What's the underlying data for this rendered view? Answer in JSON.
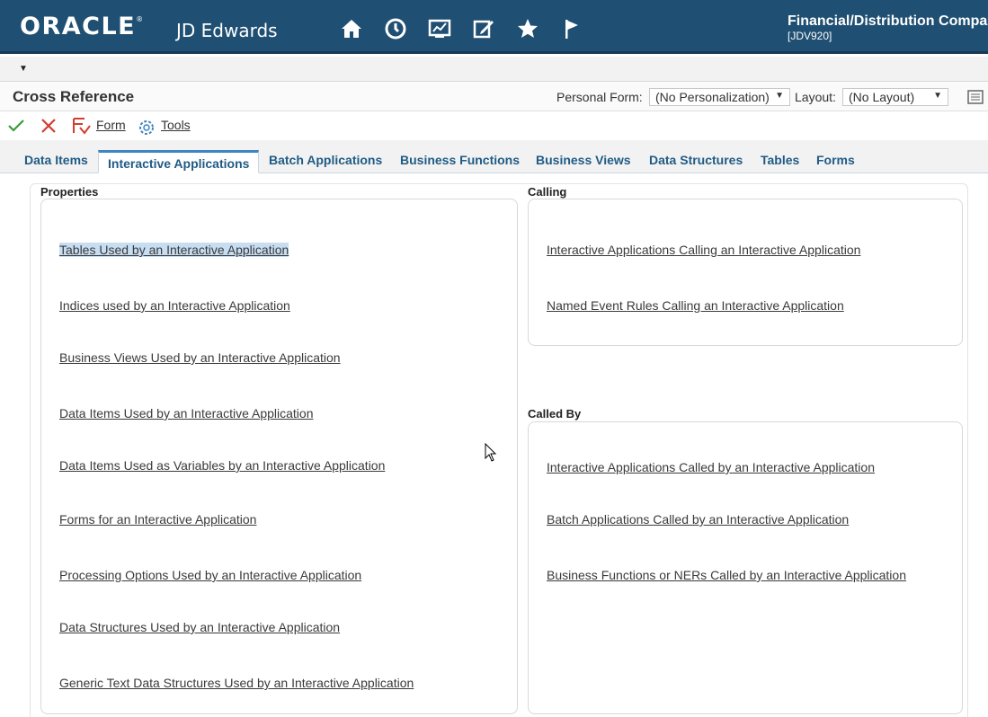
{
  "banner": {
    "logo": "ORACLE",
    "product": "JD Edwards",
    "env_name": "Financial/Distribution Compa",
    "env_code": "[JDV920]",
    "icons": [
      "home-icon",
      "recent-icon",
      "dashboard-icon",
      "edit-icon",
      "favorites-star-icon",
      "flag-icon"
    ]
  },
  "form": {
    "title": "Cross Reference",
    "personal_form_label": "Personal Form:",
    "personal_form_value": "(No Personalization)",
    "layout_label": "Layout:",
    "layout_value": "(No Layout)"
  },
  "toolbar": {
    "form_label": "Form",
    "tools_label": "Tools"
  },
  "tabs": [
    "Data Items",
    "Interactive Applications",
    "Batch Applications",
    "Business Functions",
    "Business Views",
    "Data Structures",
    "Tables",
    "Forms"
  ],
  "active_tab": "Interactive Applications",
  "properties": {
    "title": "Properties",
    "links": [
      "Tables Used by an Interactive Application",
      "Indices used by an Interactive Application",
      "Business Views Used by an Interactive Application",
      "Data Items Used by an Interactive Application",
      "Data Items Used as Variables by an Interactive Application",
      "Forms for an Interactive Application",
      "Processing Options Used by an Interactive Application",
      "Data Structures Used by an Interactive Application",
      "Generic Text Data Structures Used by an Interactive Application"
    ]
  },
  "calling": {
    "title": "Calling",
    "links": [
      "Interactive Applications Calling an Interactive Application",
      "Named Event Rules Calling an Interactive Application"
    ]
  },
  "called_by": {
    "title": "Called By",
    "links": [
      "Interactive Applications Called by an Interactive Application",
      "Batch Applications Called by an Interactive Application",
      "Business Functions or NERs Called by an Interactive Application"
    ]
  },
  "colors": {
    "banner": "#1f4f72",
    "tab_text": "#1f5b85",
    "active_tab_border": "#3c84c2",
    "ok_green": "#3a9a3a",
    "cancel_red": "#d33c2f",
    "selected_link_bg": "#c7ddf1"
  }
}
